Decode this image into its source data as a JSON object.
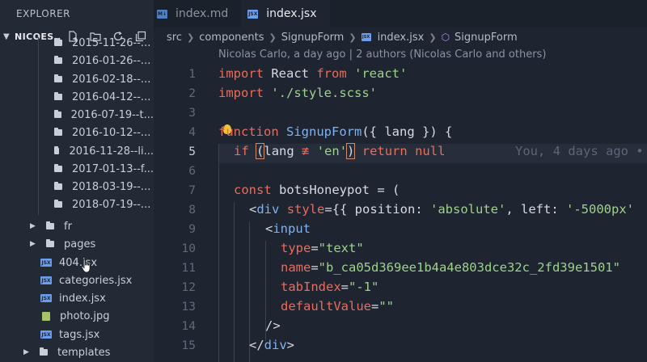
{
  "sidebar": {
    "title": "EXPLORER",
    "project": "NICOES...",
    "folders_dated": [
      "2015-11-26--...",
      "2016-01-26--...",
      "2016-02-18--...",
      "2016-04-12--...",
      "2016-07-19--t...",
      "2016-10-12--...",
      "2016-11-28--li...",
      "2017-01-13--f...",
      "2018-03-19--...",
      "2018-07-19--..."
    ],
    "fr": "fr",
    "pages": "pages",
    "files": [
      "404.jsx",
      "categories.jsx",
      "index.jsx",
      "photo.jpg",
      "tags.jsx"
    ],
    "templates": "templates"
  },
  "tabs": [
    {
      "label": "index.md",
      "icon": "markdown-icon"
    },
    {
      "label": "index.jsx",
      "icon": "jsx-icon"
    }
  ],
  "breadcrumb": {
    "parts": [
      "src",
      "components",
      "SignupForm",
      "index.jsx",
      "SignupForm"
    ]
  },
  "blame": "Nicolas Carlo, a day ago | 2 authors (Nicolas Carlo and others)",
  "ghost_text": "You, 4 days ago •",
  "line_numbers": [
    "1",
    "2",
    "3",
    "4",
    "5",
    "6",
    "7",
    "8",
    "9",
    "10",
    "11",
    "12",
    "13",
    "14",
    "15"
  ],
  "code": {
    "l1": [
      "import",
      " React ",
      "from",
      " ",
      "'react'"
    ],
    "l2": [
      "import",
      " ",
      "'./style.scss'"
    ],
    "l4": [
      "function",
      " ",
      "SignupForm",
      "({ lang }) {"
    ],
    "l5": [
      "if",
      " ",
      "(",
      "lang ",
      "≢",
      " ",
      "'en'",
      ")",
      " ",
      "return",
      " ",
      "null"
    ],
    "l7": [
      "const",
      " botsHoneypot = ("
    ],
    "l8": [
      "<",
      "div",
      " ",
      "style",
      "={{ position: ",
      "'absolute'",
      ", left: ",
      "'-5000px'"
    ],
    "l9": [
      "<",
      "input"
    ],
    "l10": [
      "type",
      "=",
      "\"text\""
    ],
    "l11": [
      "name",
      "=",
      "\"b_ca05d369ee1b4a4e803dce32c_2fd39e1501\""
    ],
    "l12": [
      "tabIndex",
      "=",
      "\"-1\""
    ],
    "l13": [
      "defaultValue",
      "=",
      "\"\""
    ],
    "l14": [
      "/>"
    ],
    "l15": [
      "</",
      "div",
      ">"
    ]
  },
  "colors": {
    "keyword": "#e96c5c",
    "string": "#9ed28c",
    "function": "#7fb2f0",
    "background": "#1e2430"
  }
}
